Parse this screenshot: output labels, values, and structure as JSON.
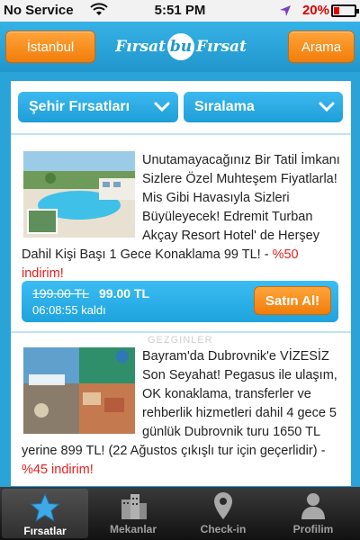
{
  "status_bar": {
    "carrier": "No Service",
    "time": "5:51 PM",
    "battery": "20%"
  },
  "header": {
    "city_button": "İstanbul",
    "logo_left": "Fırsat",
    "logo_mid": "bu",
    "logo_right": "Fırsat",
    "search_button": "Arama"
  },
  "filters": {
    "city_deals": "Şehir Fırsatları",
    "sort": "Sıralama"
  },
  "deals": [
    {
      "description": "Unutamayacağınız Bir Tatil İmkanı Sizlere Özel Muhteşem Fiyatlarla! Mis Gibi Havasıyla Sizleri Büyüleyecek! Edremit Turban Akçay Resort Hotel' de Herşey Dahil Kişi Başı 1 Gece Konaklama 99 TL! -",
      "discount": "%50 indirim!",
      "old_price": "199.00 TL",
      "new_price": "99.00 TL",
      "time_left": "06:08:55 kaldı",
      "buy_label": "Satın Al!"
    },
    {
      "description": "Bayram'da Dubrovnik'e VİZESİZ Son Seyahat! Pegasus ile ulaşım, OK konaklama, transferler ve rehberlik hizmetleri dahil 4 gece 5 günlük Dubrovnik turu 1650 TL yerine 899 TL! (22 Ağustos çıkışlı tur için geçerlidir) -",
      "discount": "%45 indirim!"
    }
  ],
  "watermark": "GEZGINLER",
  "tabs": [
    {
      "label": "Fırsatlar",
      "icon": "star-icon"
    },
    {
      "label": "Mekanlar",
      "icon": "buildings-icon"
    },
    {
      "label": "Check-in",
      "icon": "map-pin-icon"
    },
    {
      "label": "Profilim",
      "icon": "person-icon"
    }
  ],
  "colors": {
    "accent_blue": "#2aa3d8",
    "orange": "#f17d0a",
    "discount_red": "#e61e1e"
  }
}
